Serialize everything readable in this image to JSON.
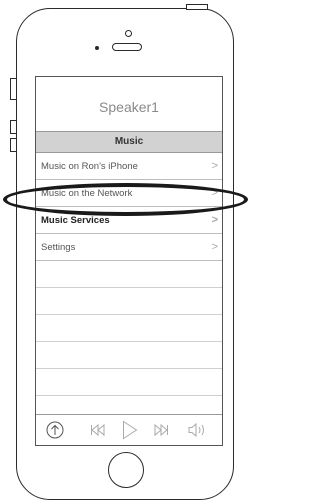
{
  "device_name": "Speaker1",
  "header_title": "Music",
  "menu_items": [
    {
      "label": "Music on Ron's iPhone",
      "bold": false
    },
    {
      "label": "Music on the Network",
      "bold": false
    },
    {
      "label": "Music Services",
      "bold": true
    },
    {
      "label": "Settings",
      "bold": false
    }
  ],
  "chevron": ">",
  "player_icons": [
    "upload-icon",
    "previous-track-icon",
    "play-icon",
    "next-track-icon",
    "volume-icon"
  ],
  "colors": {
    "header_bg": "#d2d2d2",
    "outline": "#2a2a2a",
    "highlight": "#1a1a1a"
  }
}
